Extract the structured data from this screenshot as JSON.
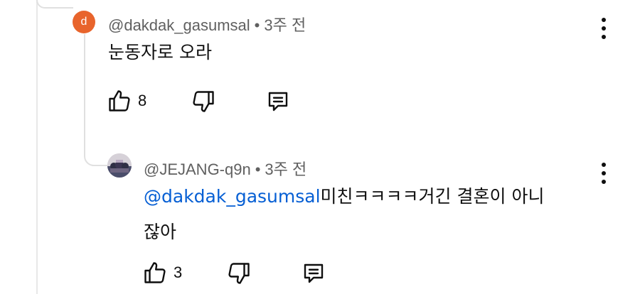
{
  "comment": {
    "avatar_letter": "d",
    "author": "@dakdak_gasumsal",
    "separator": "•",
    "time": "3주 전",
    "text": "눈동자로 오라",
    "likes": "8",
    "accent_color": "#e8642c"
  },
  "reply": {
    "author": "@JEJANG-q9n",
    "separator": "•",
    "time": "3주 전",
    "mention": "@dakdak_gasumsal",
    "text_line1": "미친ㅋㅋㅋㅋ거긴 결혼이 아니",
    "text_line2": "잖아",
    "likes": "3",
    "mention_color": "#065fd4"
  },
  "icons": {
    "like": "thumbs-up-icon",
    "dislike": "thumbs-down-icon",
    "reply": "comment-icon",
    "menu": "more-vertical-icon"
  }
}
